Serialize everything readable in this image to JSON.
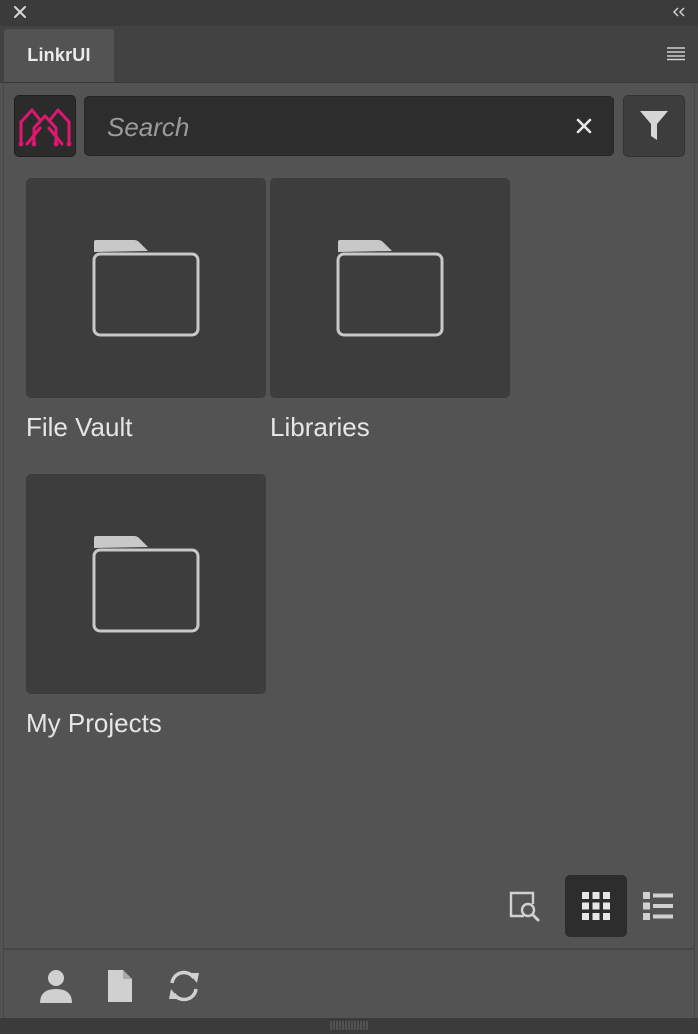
{
  "window": {
    "close_icon": "close-icon",
    "collapse_icon": "double-chevron-left-icon"
  },
  "tabs": [
    {
      "label": "LinkrUI"
    }
  ],
  "panel_menu_icon": "hamburger-icon",
  "search": {
    "placeholder": "Search",
    "value": "",
    "clear_icon": "close-icon",
    "filter_icon": "filter-icon",
    "logo": "linkr-logo"
  },
  "folders": [
    {
      "label": "File Vault"
    },
    {
      "label": "Libraries"
    },
    {
      "label": "My Projects"
    }
  ],
  "view_tools": {
    "preview_icon": "document-search-icon",
    "grid_icon": "grid-view-icon",
    "list_icon": "list-view-icon",
    "active_view": "grid"
  },
  "footer": {
    "user_icon": "user-icon",
    "file_icon": "file-icon",
    "refresh_icon": "refresh-icon"
  },
  "colors": {
    "accent": "#e0176f",
    "panel_bg": "#535353",
    "tile_bg": "#3d3d3d"
  }
}
